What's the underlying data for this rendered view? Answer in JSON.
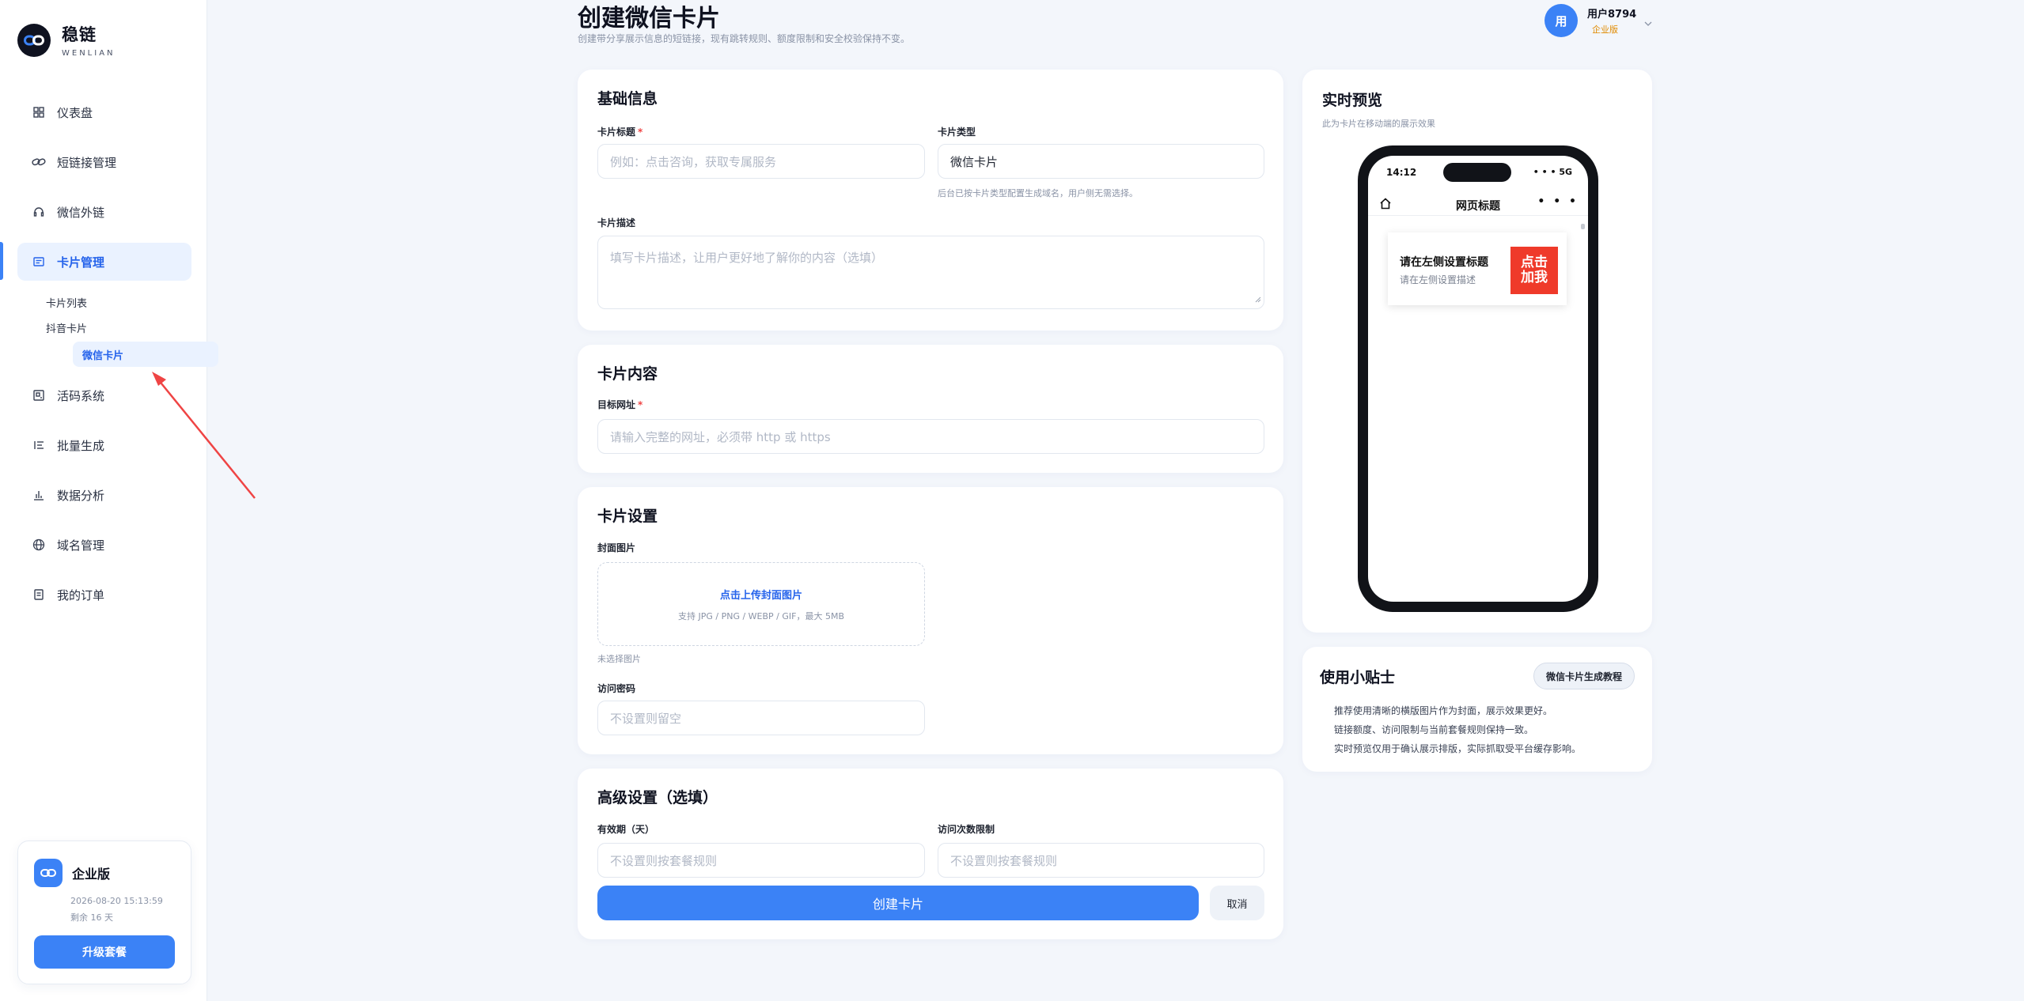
{
  "brand": {
    "name": "稳链",
    "subtitle": "WENLIAN"
  },
  "sidebar": {
    "items": [
      {
        "label": "仪表盘",
        "icon": "grid-icon"
      },
      {
        "label": "短链接管理",
        "icon": "link-icon"
      },
      {
        "label": "微信外链",
        "icon": "headset-icon"
      },
      {
        "label": "卡片管理",
        "icon": "card-icon",
        "active": true
      },
      {
        "label": "活码系统",
        "icon": "qrcode-icon"
      },
      {
        "label": "批量生成",
        "icon": "list-icon"
      },
      {
        "label": "数据分析",
        "icon": "chart-icon"
      },
      {
        "label": "域名管理",
        "icon": "globe-icon"
      },
      {
        "label": "我的订单",
        "icon": "document-icon"
      }
    ],
    "subitems": [
      {
        "label": "卡片列表"
      },
      {
        "label": "抖音卡片"
      },
      {
        "label": "微信卡片",
        "active": true
      }
    ]
  },
  "plan": {
    "name": "企业版",
    "expiry": "2026-08-20 15:13:59",
    "remaining": "剩余 16 天",
    "upgrade_label": "升级套餐"
  },
  "header": {
    "title": "创建微信卡片",
    "subtitle": "创建带分享展示信息的短链接，现有跳转规则、额度限制和安全校验保持不变。"
  },
  "user": {
    "avatar_text": "用",
    "name": "用户8794",
    "tier": "企业版"
  },
  "basic": {
    "title": "基础信息",
    "card_title_label": "卡片标题",
    "card_title_placeholder": "例如：点击咨询，获取专属服务",
    "card_type_label": "卡片类型",
    "card_type_value": "微信卡片",
    "card_type_hint": "后台已按卡片类型配置生成域名，用户侧无需选择。",
    "desc_label": "卡片描述",
    "desc_placeholder": "填写卡片描述，让用户更好地了解你的内容（选填）"
  },
  "content": {
    "title": "卡片内容",
    "url_label": "目标网址",
    "url_placeholder": "请输入完整的网址，必须带 http 或 https"
  },
  "settings": {
    "title": "卡片设置",
    "cover_label": "封面图片",
    "upload_link": "点击上传封面图片",
    "upload_hint": "支持 JPG / PNG / WEBP / GIF，最大 5MB",
    "no_image": "未选择图片",
    "password_label": "访问密码",
    "password_placeholder": "不设置则留空"
  },
  "advanced": {
    "title": "高级设置（选填）",
    "expiry_label": "有效期（天）",
    "expiry_placeholder": "不设置则按套餐规则",
    "limit_label": "访问次数限制",
    "limit_placeholder": "不设置则按套餐规则",
    "create_label": "创建卡片",
    "cancel_label": "取消"
  },
  "preview": {
    "title": "实时预览",
    "subtitle": "此为卡片在移动端的展示效果",
    "time": "14:12",
    "network": "• • • 5G",
    "page_title": "网页标题",
    "more": "• • •",
    "card_title": "请在左侧设置标题",
    "card_desc": "请在左侧设置描述",
    "thumb_text": "点击加我"
  },
  "tips": {
    "title": "使用小贴士",
    "tutorial_label": "微信卡片生成教程",
    "items": [
      "推荐使用清晰的横版图片作为封面，展示效果更好。",
      "链接额度、访问限制与当前套餐规则保持一致。",
      "实时预览仅用于确认展示排版，实际抓取受平台缓存影响。"
    ]
  },
  "colors": {
    "accent": "#3b82f6",
    "annotation": "#ef4444",
    "tier": "#e08a00"
  }
}
